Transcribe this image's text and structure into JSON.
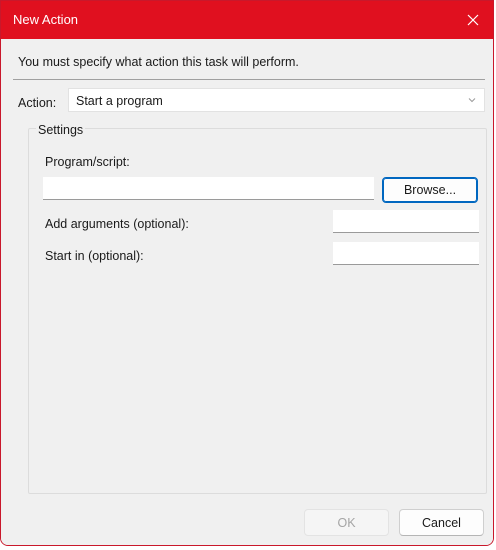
{
  "window": {
    "title": "New Action",
    "close_icon": "close-icon",
    "accent_color": "#e0101f"
  },
  "message": "You must specify what action this task will perform.",
  "action": {
    "label": "Action:",
    "selected": "Start a program",
    "dropdown_icon": "chevron-down-icon"
  },
  "settings": {
    "legend": "Settings",
    "program_label": "Program/script:",
    "program_value": "",
    "browse_label": "Browse...",
    "arguments_label": "Add arguments (optional):",
    "arguments_value": "",
    "start_in_label": "Start in (optional):",
    "start_in_value": ""
  },
  "footer": {
    "ok_label": "OK",
    "ok_enabled": false,
    "cancel_label": "Cancel"
  }
}
